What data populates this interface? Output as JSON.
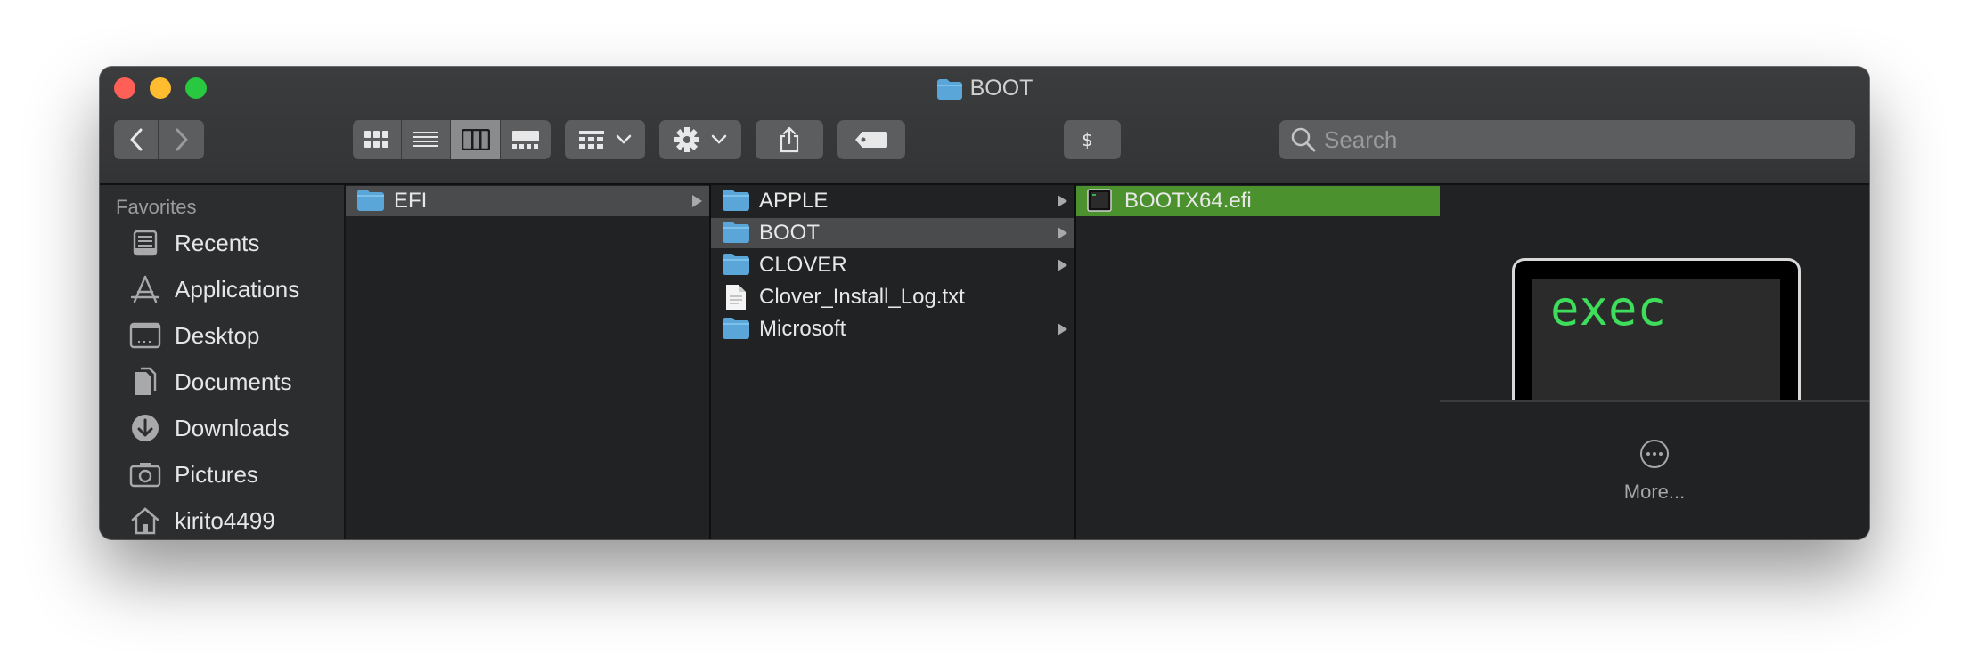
{
  "window": {
    "title": "BOOT"
  },
  "toolbar": {
    "back_icon": "chevron-left-icon",
    "forward_icon": "chevron-right-icon",
    "view_modes": [
      "icon-view-icon",
      "list-view-icon",
      "column-view-icon",
      "gallery-view-icon"
    ],
    "active_view": "column-view-icon",
    "group_icon": "group-by-icon",
    "action_icon": "gear-icon",
    "share_icon": "share-icon",
    "tag_icon": "tag-icon",
    "terminal_label": "$_",
    "search_placeholder": "Search"
  },
  "sidebar": {
    "header": "Favorites",
    "items": [
      {
        "label": "Recents",
        "icon": "recents-icon"
      },
      {
        "label": "Applications",
        "icon": "applications-icon"
      },
      {
        "label": "Desktop",
        "icon": "desktop-icon"
      },
      {
        "label": "Documents",
        "icon": "documents-icon"
      },
      {
        "label": "Downloads",
        "icon": "downloads-icon"
      },
      {
        "label": "Pictures",
        "icon": "pictures-icon"
      },
      {
        "label": "kirito4499",
        "icon": "home-icon"
      }
    ]
  },
  "columns": [
    {
      "items": [
        {
          "name": "EFI",
          "type": "folder",
          "selected": true
        }
      ]
    },
    {
      "items": [
        {
          "name": "APPLE",
          "type": "folder"
        },
        {
          "name": "BOOT",
          "type": "folder",
          "selected": true
        },
        {
          "name": "CLOVER",
          "type": "folder"
        },
        {
          "name": "Clover_Install_Log.txt",
          "type": "file"
        },
        {
          "name": "Microsoft",
          "type": "folder"
        }
      ]
    },
    {
      "items": [
        {
          "name": "BOOTX64.efi",
          "type": "exec",
          "highlighted": true
        }
      ]
    }
  ],
  "preview": {
    "thumbnail_text": "exec",
    "more_label": "More..."
  },
  "colors": {
    "highlight": "#4b922f",
    "folder": "#5aa6d8",
    "accent_text": "#3edd5b"
  }
}
